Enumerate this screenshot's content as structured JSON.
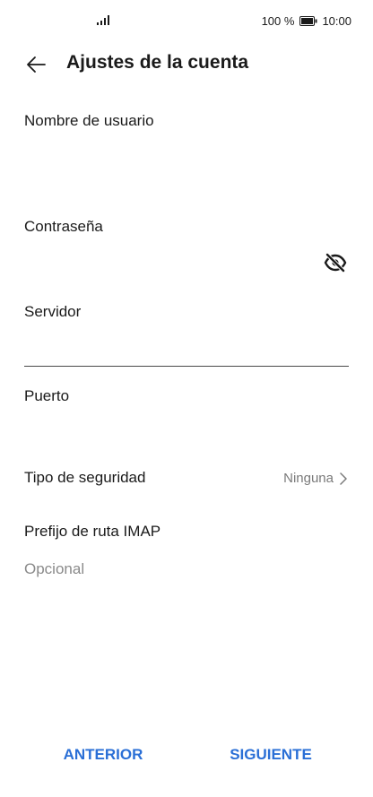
{
  "status_bar": {
    "battery_percent": "100 %",
    "time": "10:00",
    "icons": [
      "signal-icon",
      "battery-icon"
    ]
  },
  "header": {
    "title": "Ajustes de la cuenta",
    "back_icon": "arrow-left-icon"
  },
  "form": {
    "username": {
      "label": "Nombre de usuario",
      "value": ""
    },
    "password": {
      "label": "Contraseña",
      "value": "",
      "toggle_icon": "eye-off-icon"
    },
    "server": {
      "label": "Servidor",
      "value": ""
    },
    "port": {
      "label": "Puerto",
      "value": ""
    },
    "security": {
      "label": "Tipo de seguridad",
      "value": "Ninguna",
      "icon": "chevron-right-icon"
    },
    "imap_prefix": {
      "label": "Prefijo de ruta IMAP",
      "placeholder": "Opcional"
    }
  },
  "buttons": {
    "previous": "ANTERIOR",
    "next": "SIGUIENTE"
  },
  "colors": {
    "accent": "#2a6fd6",
    "secondary_text": "#7a7a7a"
  }
}
